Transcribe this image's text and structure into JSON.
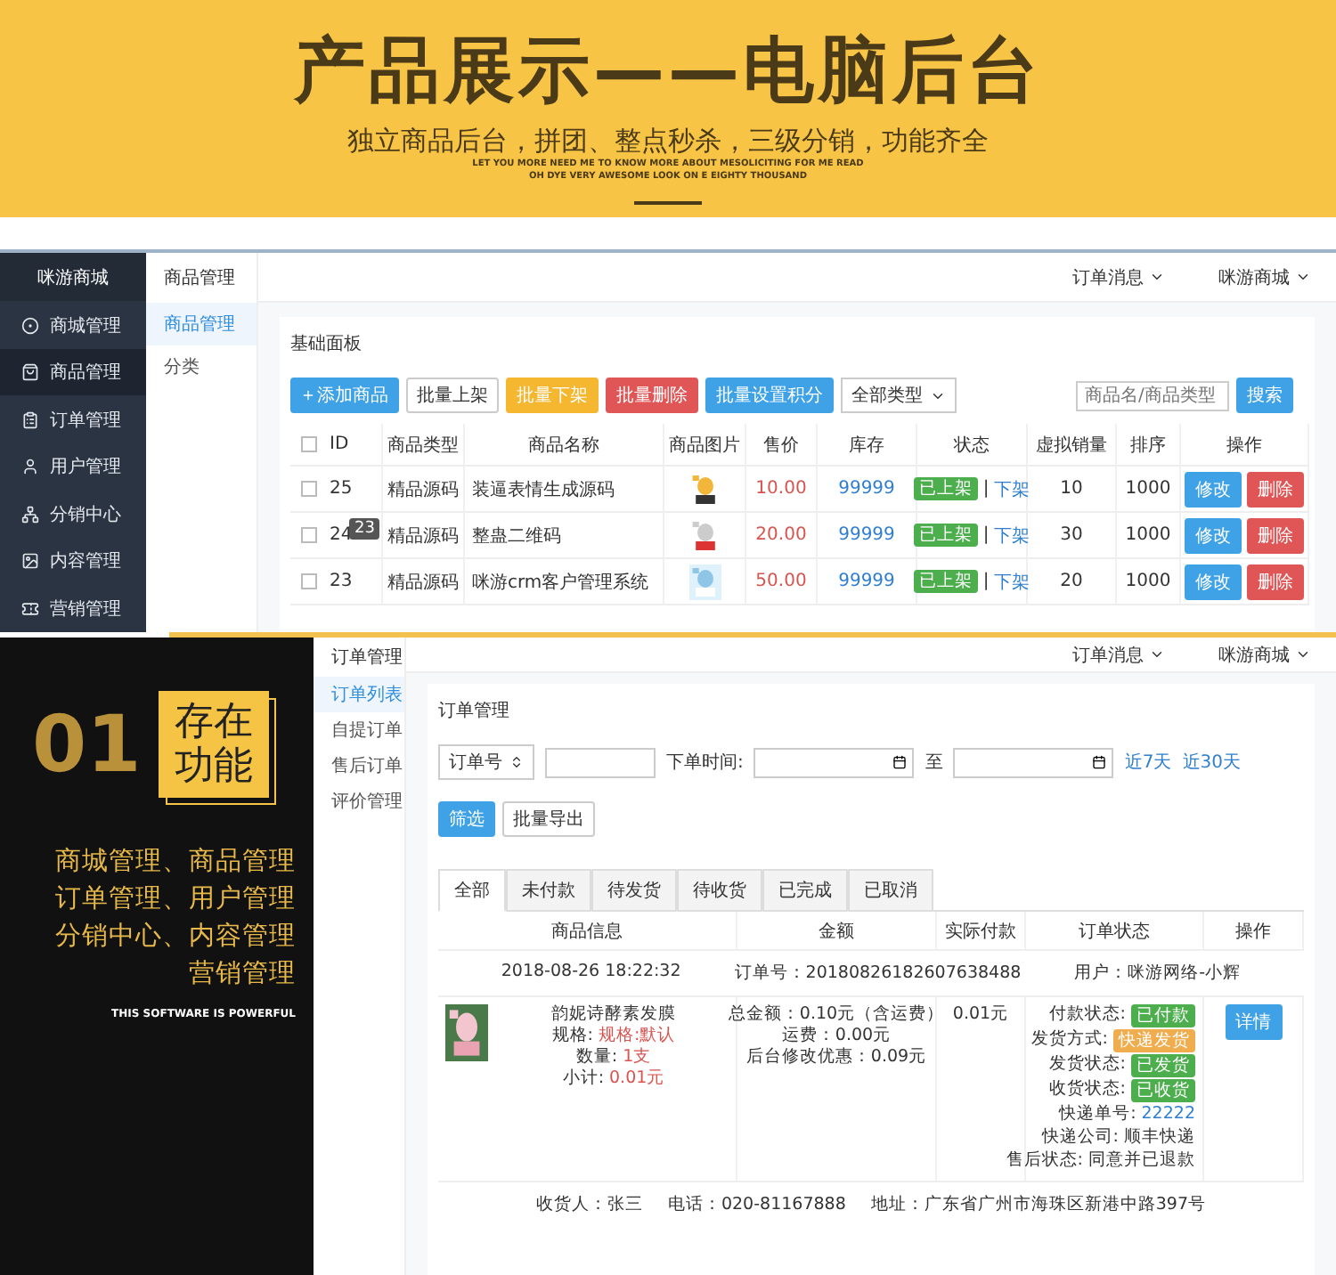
{
  "banner": {
    "title": "产品展示——电脑后台",
    "subtitle": "独立商品后台，拼团、整点秒杀，三级分销，功能齐全",
    "tagline": [
      "LET YOU MORE NEED ME TO KNOW MORE ABOUT MESOLICITING FOR ME READ",
      "OH DYE VERY AWESOME LOOK ON E EIGHTY THOUSAND"
    ]
  },
  "goods_screen": {
    "brand": "咪游商城",
    "nav": [
      {
        "label": "商城管理",
        "selected": false
      },
      {
        "label": "商品管理",
        "selected": true
      },
      {
        "label": "订单管理",
        "selected": false
      },
      {
        "label": "用户管理",
        "selected": false
      },
      {
        "label": "分销中心",
        "selected": false
      },
      {
        "label": "内容管理",
        "selected": false
      },
      {
        "label": "营销管理",
        "selected": false
      }
    ],
    "subnav_title": "商品管理",
    "subnav": [
      {
        "label": "商品管理",
        "selected": true
      },
      {
        "label": "分类",
        "selected": false
      }
    ],
    "top_menus": [
      "订单消息",
      "咪游商城"
    ],
    "panel_title": "基础面板",
    "toolbar": [
      {
        "label": "添加商品",
        "kind": "primary"
      },
      {
        "label": "批量上架",
        "kind": "default"
      },
      {
        "label": "批量下架",
        "kind": "warning"
      },
      {
        "label": "批量删除",
        "kind": "danger"
      },
      {
        "label": "批量设置积分",
        "kind": "primary"
      }
    ],
    "type_select": "全部类型",
    "search": {
      "placeholder": "商品名/商品类型",
      "button": "搜索"
    },
    "columns": [
      "ID",
      "商品类型",
      "商品名称",
      "商品图片",
      "售价",
      "库存",
      "状态",
      "虚拟销量",
      "排序",
      "操作"
    ],
    "header_checked": false,
    "rows": [
      {
        "checked": false,
        "id": "25",
        "type": "精品源码",
        "name": "装逼表情生成源码",
        "price": "10.00",
        "stock": "99999",
        "status": "已上架",
        "sep": "|",
        "off": "下架",
        "sales": "10",
        "sort": "1000",
        "edit": "修改",
        "delete": "删除"
      },
      {
        "checked": false,
        "id": "24",
        "type": "精品源码",
        "name": "整蛊二维码",
        "price": "20.00",
        "stock": "99999",
        "status": "已上架",
        "sep": "|",
        "off": "下架",
        "sales": "30",
        "sort": "1000",
        "edit": "修改",
        "delete": "删除",
        "tooltip": "23"
      },
      {
        "checked": false,
        "id": "23",
        "type": "精品源码",
        "name": "咪游crm客户管理系统",
        "price": "50.00",
        "stock": "99999",
        "status": "已上架",
        "sep": "|",
        "off": "下架",
        "sales": "20",
        "sort": "1000",
        "edit": "修改",
        "delete": "删除"
      }
    ]
  },
  "promo": {
    "number": "01",
    "badge": [
      "存在",
      "功能"
    ],
    "features": [
      "商城管理、商品管理",
      "订单管理、用户管理",
      "分销中心、内容管理",
      "营销管理"
    ],
    "footer": "THIS SOFTWARE IS POWERFUL"
  },
  "order_screen": {
    "subnav_title": "订单管理",
    "subnav": [
      {
        "label": "订单列表",
        "selected": true
      },
      {
        "label": "自提订单",
        "selected": false
      },
      {
        "label": "售后订单",
        "selected": false
      },
      {
        "label": "评价管理",
        "selected": false
      }
    ],
    "top_menus": [
      "订单消息",
      "咪游商城"
    ],
    "panel_title": "订单管理",
    "filter_select": "订单号",
    "time_label": "下单时间:",
    "range_to": "至",
    "quick_links": [
      "近7天",
      "近30天"
    ],
    "buttons": [
      {
        "label": "筛选",
        "kind": "primary"
      },
      {
        "label": "批量导出",
        "kind": "default"
      }
    ],
    "tabs": [
      {
        "label": "全部",
        "selected": true
      },
      {
        "label": "未付款",
        "selected": false
      },
      {
        "label": "待发货",
        "selected": false
      },
      {
        "label": "待收货",
        "selected": false
      },
      {
        "label": "已完成",
        "selected": false
      },
      {
        "label": "已取消",
        "selected": false
      }
    ],
    "columns": [
      "商品信息",
      "金额",
      "实际付款",
      "订单状态",
      "操作"
    ],
    "order": {
      "date": "2018-08-26 18:22:32",
      "order_no": "订单号：20180826182607638488",
      "user": "用户：咪游网络-小辉",
      "product": "韵妮诗酵素发膜",
      "specs": [
        {
          "label": "规格:",
          "value": "规格:默认"
        },
        {
          "label": "数量:",
          "value": "1支"
        },
        {
          "label": "小计:",
          "value": "0.01元"
        }
      ],
      "amounts": [
        "总金额：0.10元（含运费）",
        "运费：0.00元",
        "后台修改优惠：0.09元"
      ],
      "paid": "0.01元",
      "status": [
        {
          "label": "付款状态:",
          "value": "已付款",
          "kind": "badge",
          "color": "#4cae4c"
        },
        {
          "label": "发货方式:",
          "value": "快递发货",
          "kind": "badge",
          "color": "#f0ad4e"
        },
        {
          "label": "发货状态:",
          "value": "已发货",
          "kind": "badge",
          "color": "#4cae4c"
        },
        {
          "label": "收货状态:",
          "value": "已收货",
          "kind": "badge",
          "color": "#4cae4c"
        },
        {
          "label": "快递单号:",
          "value": "22222",
          "kind": "link"
        },
        {
          "label": "快递公司:",
          "value": "顺丰快递",
          "kind": "text"
        },
        {
          "label": "售后状态:",
          "value": "同意并已退款",
          "kind": "text"
        }
      ],
      "details": "详情",
      "receiver": [
        "收货人：张三",
        "电话：020-81167888",
        "地址：广东省广州市海珠区新港中路397号"
      ]
    }
  }
}
